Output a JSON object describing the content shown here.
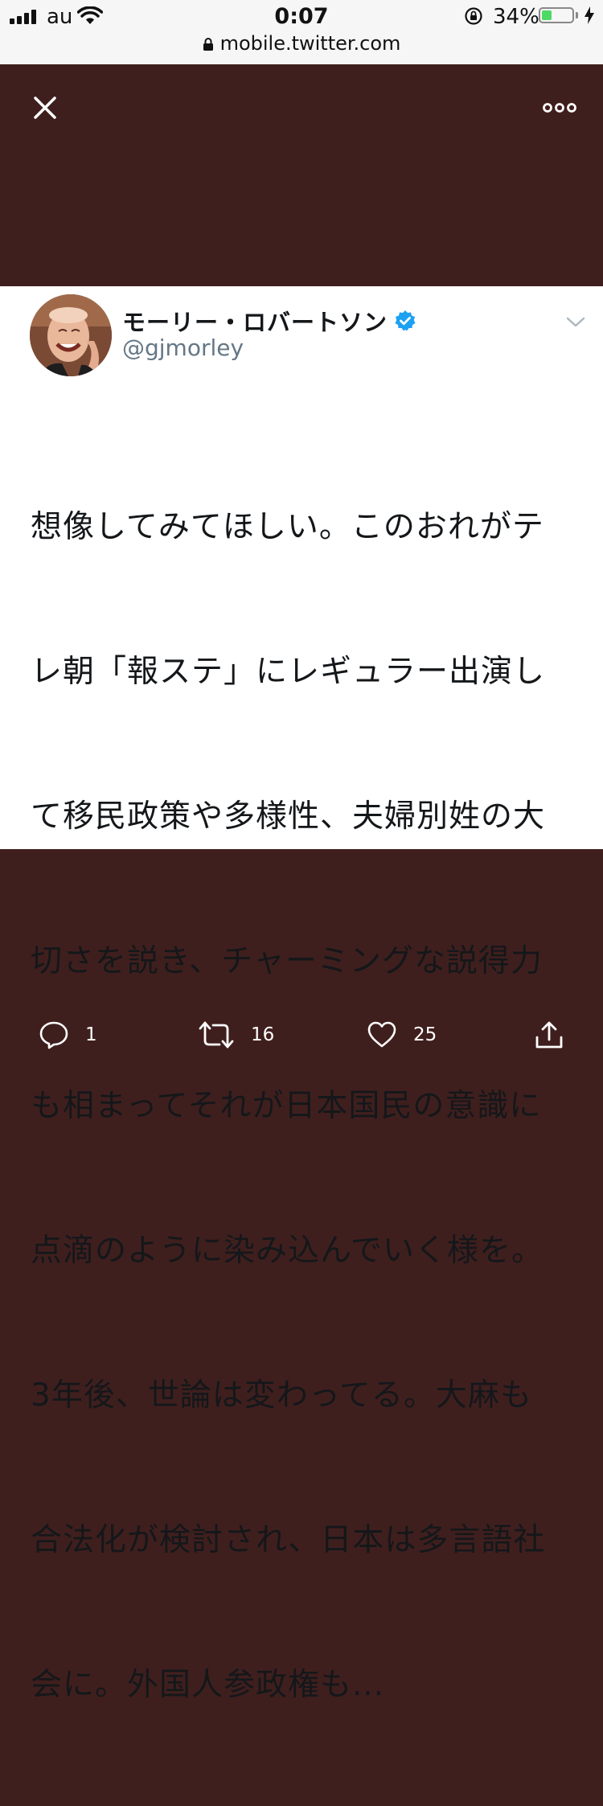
{
  "status_bar": {
    "carrier": "au",
    "time": "0:07",
    "battery_percent": "34%",
    "battery_level": 0.34,
    "url": "mobile.twitter.com"
  },
  "tweet": {
    "display_name": "モーリー・ロバートソン",
    "handle": "@gjmorley",
    "verified": true,
    "text_lines": [
      "想像してみてほしい。このおれがテ",
      "レ朝「報ステ」にレギュラー出演し",
      "て移民政策や多様性、夫婦別姓の大",
      "切さを説き、チャーミングな説得力",
      "も相まってそれが日本国民の意識に",
      "点滴のように染み込んでいく様を。",
      "3年後、世論は変わってる。大麻も",
      "合法化が検討され、日本は多言語社",
      "会に。外国人参政権も..."
    ]
  },
  "actions": {
    "reply_count": "1",
    "retweet_count": "16",
    "like_count": "25"
  },
  "icons": {
    "close": "close-icon",
    "more": "more-icon",
    "reply": "reply-icon",
    "retweet": "retweet-icon",
    "like": "heart-icon",
    "share": "share-icon",
    "verified": "verified-icon"
  },
  "colors": {
    "backdrop": "#3f1f1e",
    "verified": "#1da1f2",
    "handle": "#657786"
  }
}
